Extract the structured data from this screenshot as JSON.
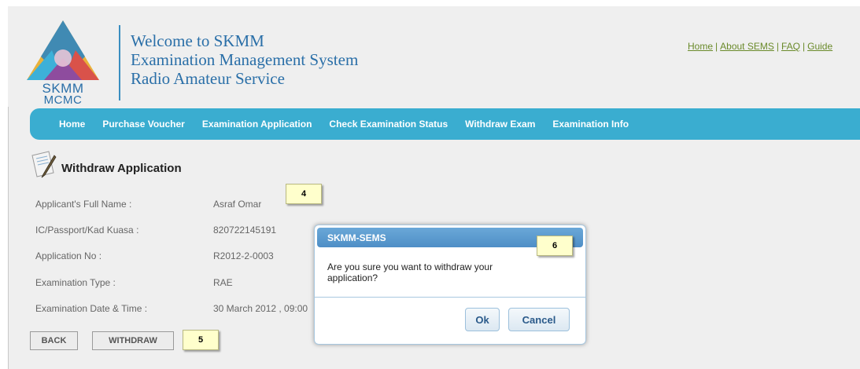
{
  "site": {
    "title_lines": [
      "Welcome to SKMM",
      "Examination Management System",
      "Radio Amateur Service"
    ],
    "logo_text_top": "SKMM",
    "logo_text_bottom": "MCMC"
  },
  "top_links": [
    "Home",
    "About SEMS",
    "FAQ",
    "Guide"
  ],
  "nav": [
    "Home",
    "Purchase Voucher",
    "Examination Application",
    "Check Examination Status",
    "Withdraw Exam",
    "Examination Info"
  ],
  "section": {
    "title": "Withdraw Application"
  },
  "fields": [
    {
      "label": "Applicant's Full Name :",
      "value": "Asraf Omar"
    },
    {
      "label": "IC/Passport/Kad Kuasa :",
      "value": "820722145191"
    },
    {
      "label": "Application No :",
      "value": "R2012-2-0003"
    },
    {
      "label": "Examination Type :",
      "value": "RAE"
    },
    {
      "label": "Examination Date & Time :",
      "value": "30 March 2012 , 09:00"
    }
  ],
  "buttons": {
    "back": "BACK",
    "withdraw": "WITHDRAW"
  },
  "callouts": {
    "name": "4",
    "withdraw": "5",
    "dialog": "6"
  },
  "dialog": {
    "title": "SKMM-SEMS",
    "message": "Are you sure you want to withdraw your application?",
    "ok": "Ok",
    "cancel": "Cancel"
  },
  "colors": {
    "nav_bg": "#3aadd0",
    "title_blue": "#2a6fa8",
    "link_green": "#6a8a2a",
    "dialog_header": "#5a9ad0"
  }
}
